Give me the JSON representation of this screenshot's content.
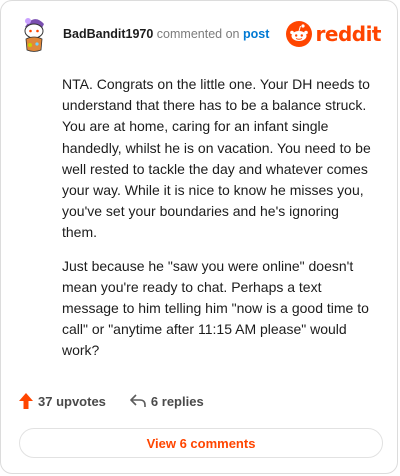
{
  "header": {
    "author": "BadBandit1970",
    "commented_on": "commented on",
    "post_link": "post",
    "logo_text": "reddit"
  },
  "comment": {
    "paragraphs": [
      "NTA. Congrats on the little one. Your DH needs to understand that there has to be a balance struck. You are at home, caring for an infant single handedly, whilst he is on vacation. You need to be well rested to tackle the day and whatever comes your way. While it is nice to know he misses you, you've set your boundaries and he's ignoring them.",
      "Just because he \"saw you were online\" doesn't mean you're ready to chat. Perhaps a text message to him telling him \"now is a good time to call\" or \"anytime after 11:15 AM please\" would work?"
    ]
  },
  "actions": {
    "upvotes": "37 upvotes",
    "replies": "6 replies"
  },
  "footer": {
    "view_comments": "View 6 comments"
  },
  "colors": {
    "brand": "#ff4500",
    "link": "#0079d3",
    "text": "#1c1c1c",
    "muted": "#7c7c7c"
  },
  "icons": {
    "avatar": "snoo-avatar-icon",
    "logo": "reddit-logo-icon",
    "upvote": "upvote-arrow-icon",
    "reply": "reply-arrow-icon"
  }
}
